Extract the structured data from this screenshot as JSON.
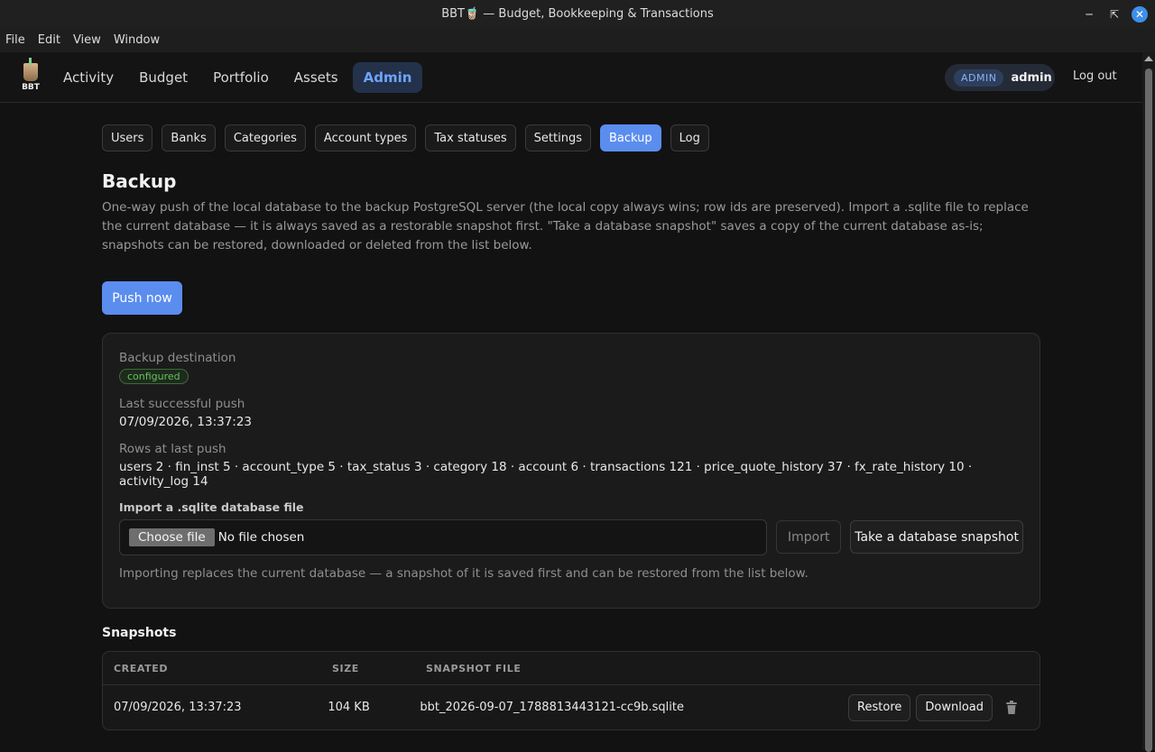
{
  "window": {
    "title": "BBT🧋 — Budget, Bookkeeping & Transactions"
  },
  "menubar": [
    "File",
    "Edit",
    "Window"
  ],
  "menubar_view": "View",
  "nav": {
    "logo_text": "BBT",
    "items": [
      "Activity",
      "Budget",
      "Portfolio",
      "Assets",
      "Admin"
    ],
    "active": "Admin",
    "role_badge": "ADMIN",
    "username": "admin",
    "logout": "Log out"
  },
  "subtabs": [
    "Users",
    "Banks",
    "Categories",
    "Account types",
    "Tax statuses",
    "Settings",
    "Backup",
    "Log"
  ],
  "active_subtab": "Backup",
  "page": {
    "title": "Backup",
    "description": "One-way push of the local database to the backup PostgreSQL server (the local copy always wins; row ids are preserved). Import a .sqlite file to replace the current database — it is always saved as a restorable snapshot first. \"Take a database snapshot\" saves a copy of the current database as-is; snapshots can be restored, downloaded or deleted from the list below.",
    "push_button": "Push now"
  },
  "card": {
    "destination_label": "Backup destination",
    "destination_status": "configured",
    "last_push_label": "Last successful push",
    "last_push_value": "07/09/2026, 13:37:23",
    "rows_label": "Rows at last push",
    "rows_value": "users 2 · fin_inst 5 · account_type 5 · tax_status 3 · category 18 · account 6 · transactions 121 · price_quote_history 37 · fx_rate_history 10 · activity_log 14",
    "import_label": "Import a .sqlite database file",
    "choose_file": "Choose file",
    "no_file": "No file chosen",
    "import_button": "Import",
    "snapshot_button": "Take a database snapshot",
    "hint": "Importing replaces the current database — a snapshot of it is saved first and can be restored from the list below."
  },
  "snapshots": {
    "title": "Snapshots",
    "columns": [
      "CREATED",
      "SIZE",
      "SNAPSHOT FILE"
    ],
    "rows": [
      {
        "created": "07/09/2026, 13:37:23",
        "size": "104 KB",
        "file": "bbt_2026-09-07_1788813443121-cc9b.sqlite",
        "restore": "Restore",
        "download": "Download"
      }
    ]
  },
  "colors": {
    "accent": "#5b8def",
    "success": "#66c25e"
  }
}
